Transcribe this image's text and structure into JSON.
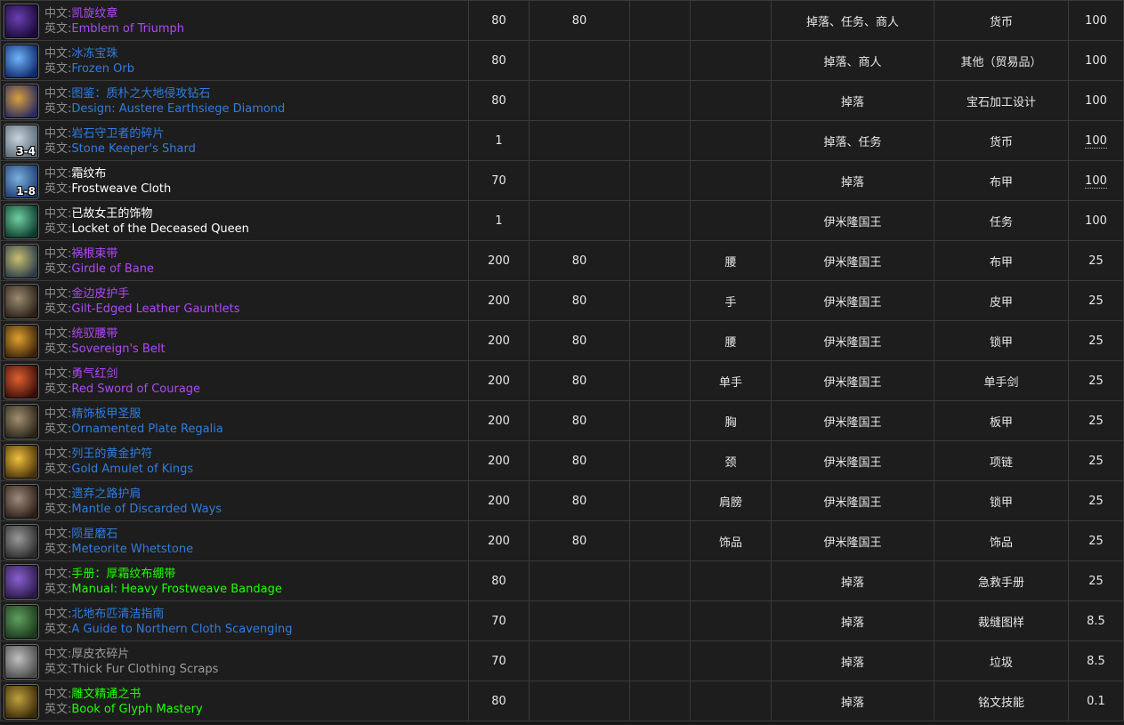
{
  "labels": {
    "cn": "中文:",
    "en": "英文:"
  },
  "rows": [
    {
      "cn": "凯旋纹章",
      "en": "Emblem of Triumph",
      "quality": "epic",
      "icon": "emblem-icon",
      "icon_colors": [
        "#6a3fb0",
        "#1a0a3a"
      ],
      "stack": "",
      "c1": "80",
      "c2": "80",
      "c3": "",
      "c4": "",
      "source": "掉落、任务、商人",
      "type": "货币",
      "pct": "100",
      "pct_dotted": false
    },
    {
      "cn": "冰冻宝珠",
      "en": "Frozen Orb",
      "quality": "rare",
      "icon": "frozen-orb-icon",
      "icon_colors": [
        "#6fb4ff",
        "#102a6a"
      ],
      "stack": "",
      "c1": "80",
      "c2": "",
      "c3": "",
      "c4": "",
      "source": "掉落、商人",
      "type": "其他（贸易品）",
      "pct": "100",
      "pct_dotted": false
    },
    {
      "cn": "图鉴：质朴之大地侵攻钻石",
      "en": "Design: Austere Earthsiege Diamond",
      "quality": "rare",
      "icon": "design-scroll-icon",
      "icon_colors": [
        "#d8a040",
        "#2a2a60"
      ],
      "stack": "",
      "c1": "80",
      "c2": "",
      "c3": "",
      "c4": "",
      "source": "掉落",
      "type": "宝石加工设计",
      "pct": "100",
      "pct_dotted": false
    },
    {
      "cn": "岩石守卫者的碎片",
      "en": "Stone Keeper's Shard",
      "quality": "rare",
      "icon": "shard-icon",
      "icon_colors": [
        "#c8d4dc",
        "#5a6a78"
      ],
      "stack": "3-4",
      "c1": "1",
      "c2": "",
      "c3": "",
      "c4": "",
      "source": "掉落、任务",
      "type": "货币",
      "pct": "100",
      "pct_dotted": true
    },
    {
      "cn": "霜纹布",
      "en": "Frostweave Cloth",
      "quality": "common",
      "icon": "cloth-icon",
      "icon_colors": [
        "#7ab0e0",
        "#1e3e70"
      ],
      "stack": "1-8",
      "c1": "70",
      "c2": "",
      "c3": "",
      "c4": "",
      "source": "掉落",
      "type": "布甲",
      "pct": "100",
      "pct_dotted": true
    },
    {
      "cn": "已故女王的饰物",
      "en": "Locket of the Deceased Queen",
      "quality": "common",
      "icon": "locket-icon",
      "icon_colors": [
        "#6fd0a0",
        "#0e3a30"
      ],
      "stack": "",
      "c1": "1",
      "c2": "",
      "c3": "",
      "c4": "",
      "source": "伊米隆国王",
      "type": "任务",
      "pct": "100",
      "pct_dotted": false
    },
    {
      "cn": "祸根束带",
      "en": "Girdle of Bane",
      "quality": "epic",
      "icon": "girdle-icon",
      "icon_colors": [
        "#c8c070",
        "#2a3a4a"
      ],
      "stack": "",
      "c1": "200",
      "c2": "80",
      "c3": "腰",
      "c4": "",
      "source": "伊米隆国王",
      "type": "布甲",
      "pct": "25",
      "pct_dotted": false
    },
    {
      "cn": "金边皮护手",
      "en": "Gilt-Edged Leather Gauntlets",
      "quality": "epic",
      "icon": "gauntlets-icon",
      "icon_colors": [
        "#9a8a70",
        "#2a2018"
      ],
      "stack": "",
      "c1": "200",
      "c2": "80",
      "c3": "手",
      "c4": "",
      "source": "伊米隆国王",
      "type": "皮甲",
      "pct": "25",
      "pct_dotted": false
    },
    {
      "cn": "统驭腰带",
      "en": "Sovereign's Belt",
      "quality": "epic",
      "icon": "belt-icon",
      "icon_colors": [
        "#e0a030",
        "#3a2208"
      ],
      "stack": "",
      "c1": "200",
      "c2": "80",
      "c3": "腰",
      "c4": "",
      "source": "伊米隆国王",
      "type": "锁甲",
      "pct": "25",
      "pct_dotted": false
    },
    {
      "cn": "勇气红剑",
      "en": "Red Sword of Courage",
      "quality": "epic",
      "icon": "sword-icon",
      "icon_colors": [
        "#e06030",
        "#3a0e08"
      ],
      "stack": "",
      "c1": "200",
      "c2": "80",
      "c3": "单手",
      "c4": "",
      "source": "伊米隆国王",
      "type": "单手剑",
      "pct": "25",
      "pct_dotted": false
    },
    {
      "cn": "精饰板甲圣服",
      "en": "Ornamented Plate Regalia",
      "quality": "rare",
      "icon": "chest-armor-icon",
      "icon_colors": [
        "#a09070",
        "#2a2418"
      ],
      "stack": "",
      "c1": "200",
      "c2": "80",
      "c3": "胸",
      "c4": "",
      "source": "伊米隆国王",
      "type": "板甲",
      "pct": "25",
      "pct_dotted": false
    },
    {
      "cn": "列王的黄金护符",
      "en": "Gold Amulet of Kings",
      "quality": "rare",
      "icon": "amulet-icon",
      "icon_colors": [
        "#f0c040",
        "#4a3208"
      ],
      "stack": "",
      "c1": "200",
      "c2": "80",
      "c3": "颈",
      "c4": "",
      "source": "伊米隆国王",
      "type": "项链",
      "pct": "25",
      "pct_dotted": false
    },
    {
      "cn": "遗弃之路护肩",
      "en": "Mantle of Discarded Ways",
      "quality": "rare",
      "icon": "shoulder-icon",
      "icon_colors": [
        "#a08a7a",
        "#2a1e18"
      ],
      "stack": "",
      "c1": "200",
      "c2": "80",
      "c3": "肩膀",
      "c4": "",
      "source": "伊米隆国王",
      "type": "锁甲",
      "pct": "25",
      "pct_dotted": false
    },
    {
      "cn": "陨星磨石",
      "en": "Meteorite Whetstone",
      "quality": "rare",
      "icon": "whetstone-icon",
      "icon_colors": [
        "#9a9a9a",
        "#2a2a2a"
      ],
      "stack": "",
      "c1": "200",
      "c2": "80",
      "c3": "饰品",
      "c4": "",
      "source": "伊米隆国王",
      "type": "饰品",
      "pct": "25",
      "pct_dotted": false
    },
    {
      "cn": "手册：厚霜纹布绷带",
      "en": "Manual: Heavy Frostweave Bandage",
      "quality": "uncommon",
      "icon": "manual-book-icon",
      "icon_colors": [
        "#8a60d0",
        "#2a1a4a"
      ],
      "stack": "",
      "c1": "80",
      "c2": "",
      "c3": "",
      "c4": "",
      "source": "掉落",
      "type": "急救手册",
      "pct": "25",
      "pct_dotted": false
    },
    {
      "cn": "北地布匹清洁指南",
      "en": "A Guide to Northern Cloth Scavenging",
      "quality": "rare",
      "icon": "guide-book-icon",
      "icon_colors": [
        "#60a060",
        "#1a3a1a"
      ],
      "stack": "",
      "c1": "70",
      "c2": "",
      "c3": "",
      "c4": "",
      "source": "掉落",
      "type": "裁缝图样",
      "pct": "8.5",
      "pct_dotted": false
    },
    {
      "cn": "厚皮衣碎片",
      "en": "Thick Fur Clothing Scraps",
      "quality": "poor",
      "icon": "scraps-icon",
      "icon_colors": [
        "#c0c0c0",
        "#4a4a4a"
      ],
      "stack": "",
      "c1": "70",
      "c2": "",
      "c3": "",
      "c4": "",
      "source": "掉落",
      "type": "垃圾",
      "pct": "8.5",
      "pct_dotted": false
    },
    {
      "cn": "雕文精通之书",
      "en": "Book of Glyph Mastery",
      "quality": "uncommon",
      "icon": "glyph-book-icon",
      "icon_colors": [
        "#c0a040",
        "#3a2a08"
      ],
      "stack": "",
      "c1": "80",
      "c2": "",
      "c3": "",
      "c4": "",
      "source": "掉落",
      "type": "铭文技能",
      "pct": "0.1",
      "pct_dotted": false
    }
  ]
}
